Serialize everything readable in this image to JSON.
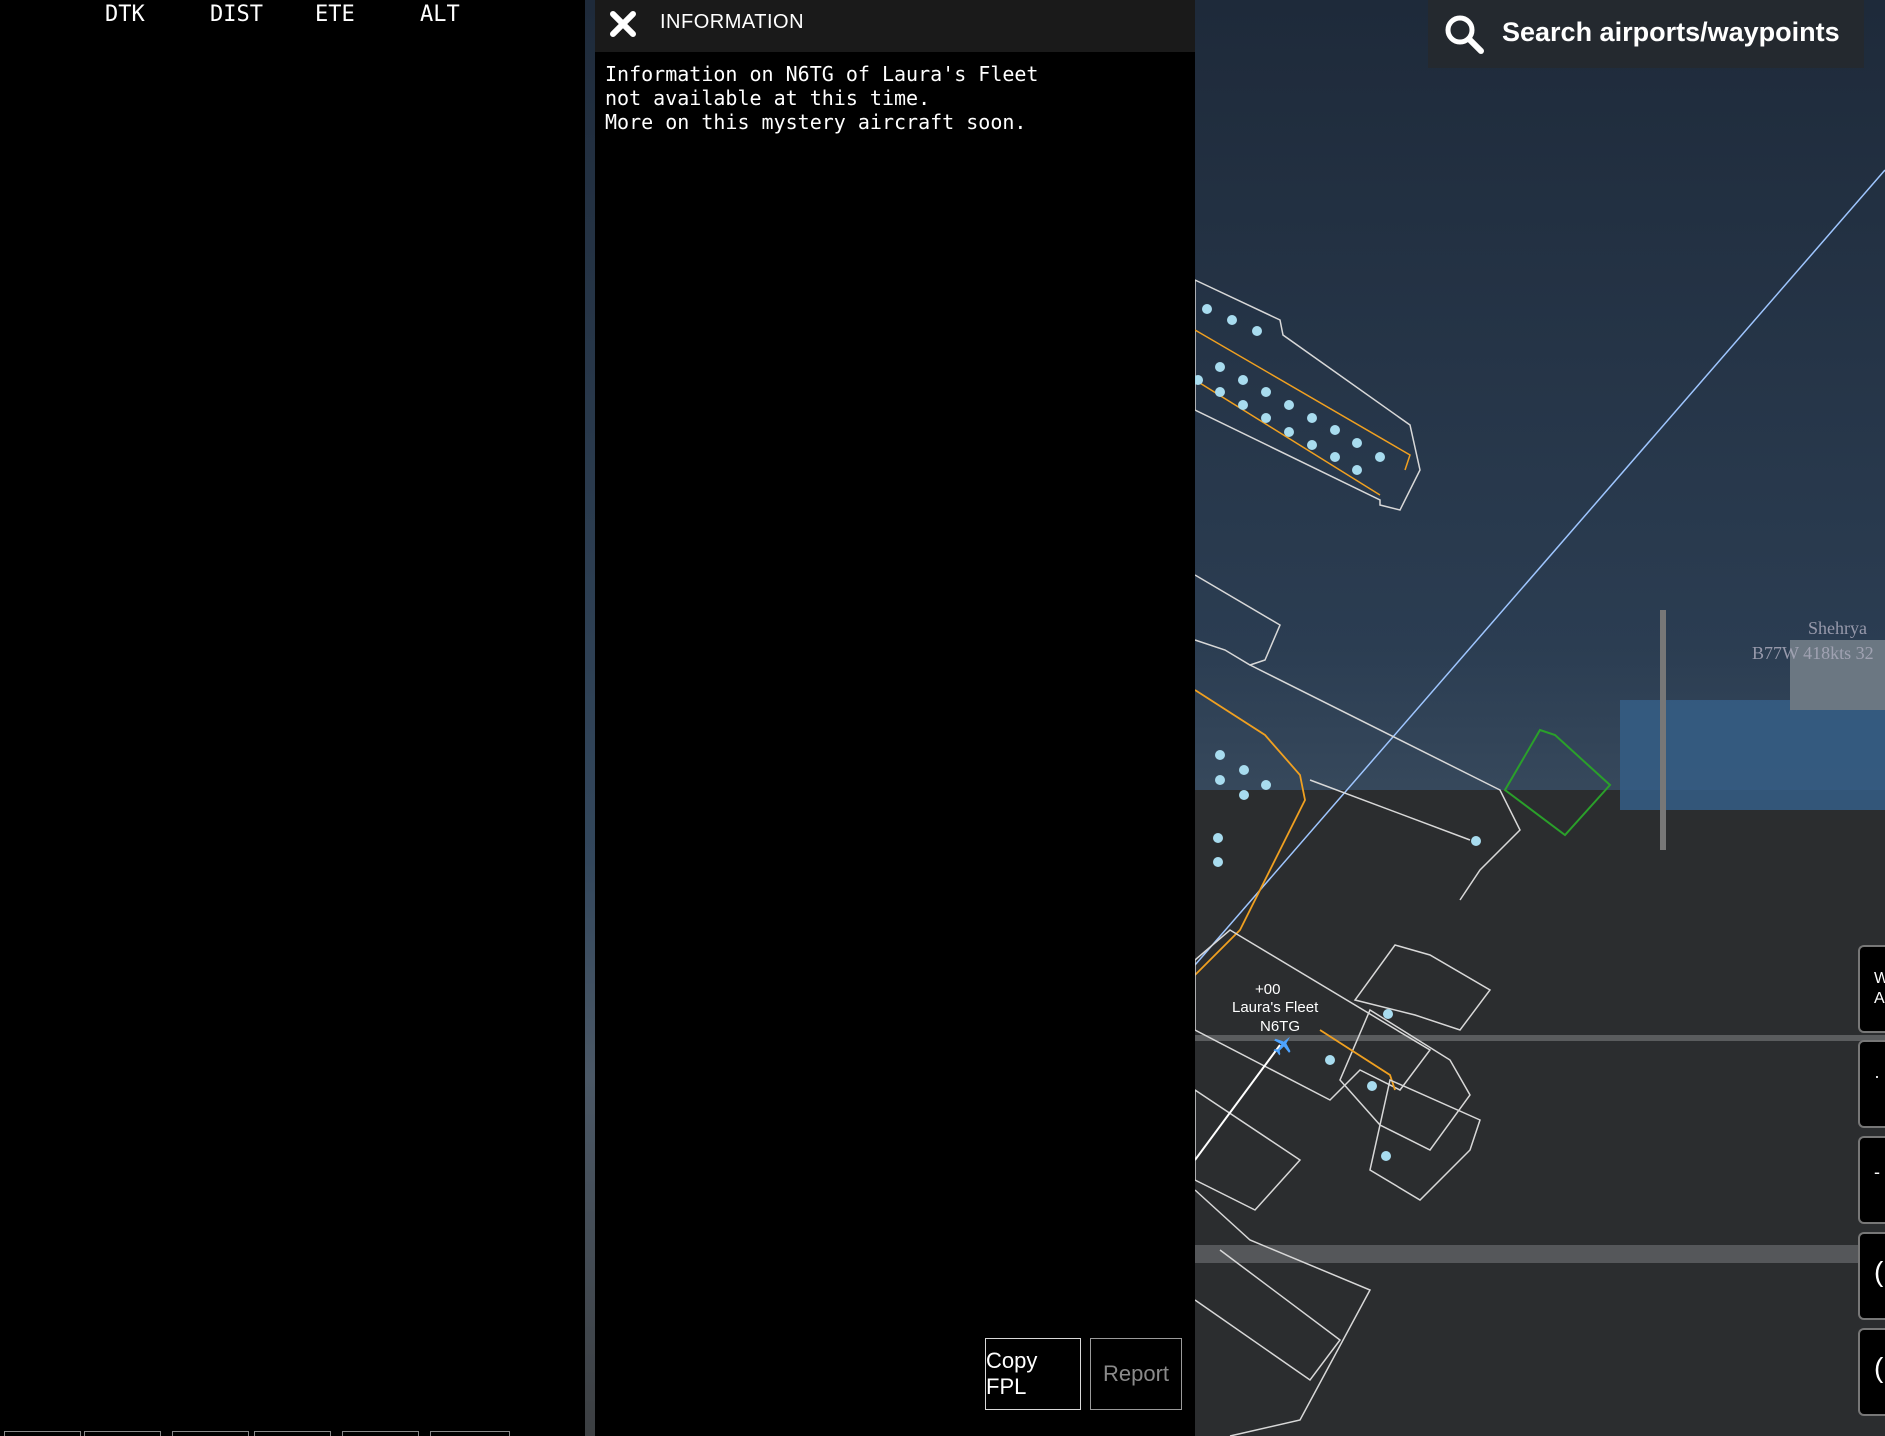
{
  "flight_plan": {
    "columns": [
      "DTK",
      "DIST",
      "ETE",
      "ALT"
    ]
  },
  "info_panel": {
    "title": "INFORMATION",
    "body_lines": [
      "Information on N6TG of Laura's Fleet",
      "not available at this time.",
      "More on this mystery aircraft soon."
    ],
    "copy_fpl_label": "Copy FPL",
    "report_label": "Report"
  },
  "search": {
    "label": "Search airports/waypoints"
  },
  "map": {
    "own_aircraft": {
      "altitude": "+00",
      "operator": "Laura's Fleet",
      "callsign": "N6TG"
    },
    "traffic": {
      "name": "Shehrya",
      "info": "B77W 418kts 32"
    }
  },
  "side_buttons": [
    "W\nA",
    "·",
    "-",
    "(",
    "("
  ],
  "colors": {
    "taxiway": "#f0a020",
    "gate": "#a8dcef",
    "route_line": "#9fc6ff",
    "outline": "#d8d8d8",
    "highlight": "#2aa02a"
  }
}
